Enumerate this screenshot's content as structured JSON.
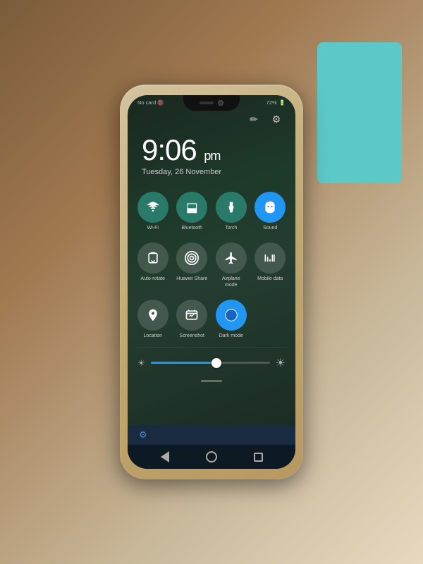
{
  "background": {
    "hand_gradient": "linear-gradient(135deg, #7a5c3a, #c8b89a)"
  },
  "status_bar": {
    "no_card": "No card",
    "battery": "72%"
  },
  "time": {
    "hour_minute": "9:06",
    "ampm": "pm",
    "date": "Tuesday, 26 November"
  },
  "top_icons": {
    "edit": "✏",
    "settings": "⚙"
  },
  "toggles_row1": [
    {
      "id": "wifi",
      "icon": "📶",
      "label": "Wi-Fi",
      "active": false
    },
    {
      "id": "bluetooth",
      "icon": "🔵",
      "label": "Bluetooth",
      "active": false
    },
    {
      "id": "torch",
      "icon": "🔦",
      "label": "Torch",
      "active": false
    },
    {
      "id": "sound",
      "icon": "🔔",
      "label": "Sound",
      "active": true
    }
  ],
  "toggles_row2": [
    {
      "id": "auto-rotate",
      "icon": "⟳",
      "label": "Auto-rotate",
      "active": false
    },
    {
      "id": "huawei-share",
      "icon": "📡",
      "label": "Huawei Share",
      "active": false
    },
    {
      "id": "airplane",
      "icon": "✈",
      "label": "Airplane mode",
      "active": false
    },
    {
      "id": "mobile-data",
      "icon": "📶",
      "label": "Mobile data",
      "active": false
    }
  ],
  "toggles_row3": [
    {
      "id": "location",
      "icon": "📍",
      "label": "Location",
      "active": false
    },
    {
      "id": "screenshot",
      "icon": "📷",
      "label": "Screenshot",
      "active": false
    },
    {
      "id": "dark-mode",
      "icon": "◑",
      "label": "Dark mode",
      "active": true
    }
  ],
  "brightness": {
    "value": 55,
    "min_icon": "☀",
    "max_icon": "☀"
  },
  "nav": {
    "back": "◁",
    "home": "○",
    "recent": "□"
  }
}
